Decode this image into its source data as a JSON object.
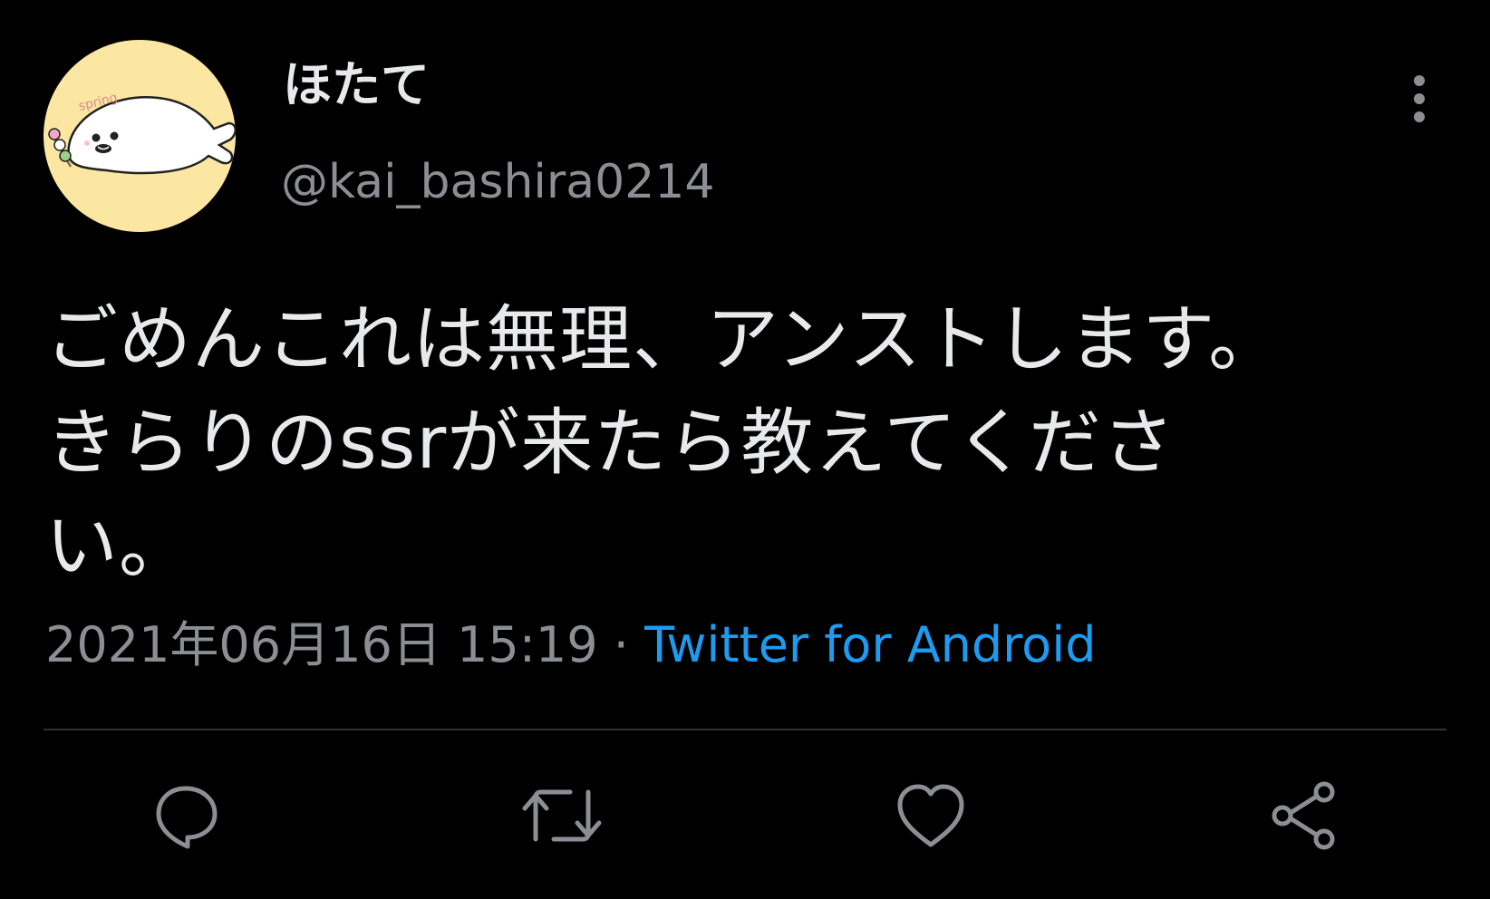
{
  "tweet": {
    "avatar_icon": "seal-avatar-icon",
    "avatar_text": "spring",
    "display_name": "ほたて",
    "handle": "@kai_bashira0214",
    "text_lines": [
      "ごめんこれは無理、アンストします。",
      "きらりのssrが来たら教えてくださ",
      "い。"
    ],
    "timestamp": "2021年06月16日 15:19",
    "separator": " · ",
    "source": "Twitter for Android"
  },
  "actions": [
    {
      "icon": "reply-icon"
    },
    {
      "icon": "retweet-icon"
    },
    {
      "icon": "like-icon"
    },
    {
      "icon": "share-icon"
    }
  ],
  "colors": {
    "background": "#000000",
    "text": "#e7e9ea",
    "secondary": "#8b8f94",
    "link": "#1d9bf0",
    "divider": "#2f3336",
    "avatar_bg": "#fbe6a2"
  }
}
